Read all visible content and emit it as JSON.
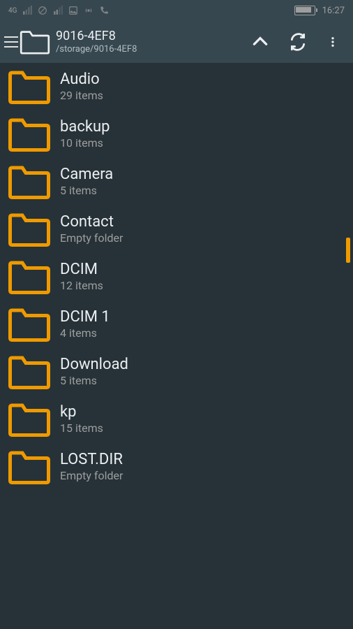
{
  "status": {
    "time": "16:27"
  },
  "header": {
    "title": "9016-4EF8",
    "path": "/storage/9016-4EF8"
  },
  "folders": [
    {
      "name": "Audio",
      "sub": "29 items"
    },
    {
      "name": "backup",
      "sub": "10 items"
    },
    {
      "name": "Camera",
      "sub": "5 items"
    },
    {
      "name": "Contact",
      "sub": "Empty folder"
    },
    {
      "name": "DCIM",
      "sub": "12 items"
    },
    {
      "name": "DCIM 1",
      "sub": "4 items"
    },
    {
      "name": "Download",
      "sub": "5 items"
    },
    {
      "name": "kp",
      "sub": "15 items"
    },
    {
      "name": "LOST.DIR",
      "sub": "Empty folder"
    }
  ],
  "colors": {
    "folder": "#ef9a00",
    "bg": "#263238",
    "bar": "#37474f"
  }
}
